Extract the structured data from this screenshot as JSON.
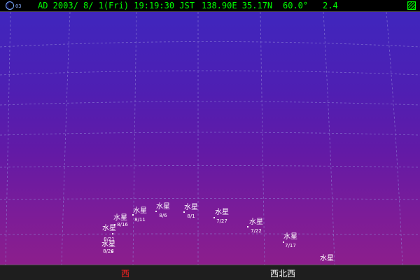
{
  "status": {
    "moon_age": "03",
    "datetime": "AD 2003/ 8/ 1(Fri) 19:19:30 JST",
    "location": "138.90E 35.17N",
    "fov": "60.0°",
    "magnitude": "2.4",
    "text_color": "#00ff00"
  },
  "sky": {
    "objects": [
      {
        "name": "水星",
        "date": "8/26"
      },
      {
        "name": "水星",
        "date": "8/21"
      },
      {
        "name": "水星",
        "date": "8/16"
      },
      {
        "name": "水星",
        "date": "8/11"
      },
      {
        "name": "水星",
        "date": "8/6"
      },
      {
        "name": "水星",
        "date": "8/1"
      },
      {
        "name": "水星",
        "date": "7/27"
      },
      {
        "name": "水星",
        "date": "7/22"
      },
      {
        "name": "水星",
        "date": "7/17"
      },
      {
        "name": "水星",
        "date": ""
      }
    ]
  },
  "horizon": {
    "directions": [
      {
        "label": "西",
        "color": "#ff2020"
      },
      {
        "label": "西北西",
        "color": "#ffffff"
      }
    ]
  },
  "colors": {
    "sky_top": "#3f26bd",
    "sky_bottom": "#8c1e8c",
    "grid": "#8f86d6"
  }
}
